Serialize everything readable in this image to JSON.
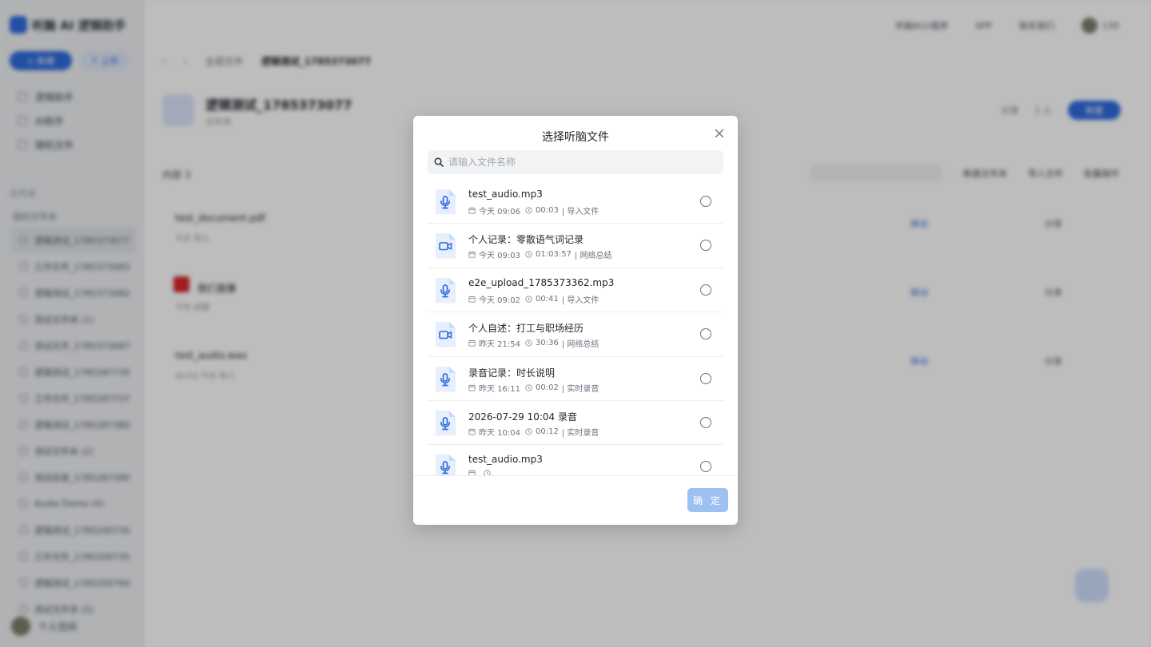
{
  "app": {
    "logo_text": "听脑 AI 逻辑助手",
    "new_button": "+ 新建",
    "upload_button": "↑ 上传",
    "nav": [
      "逻辑助手",
      "AI助手",
      "随机文件"
    ],
    "section_label": "文件夹",
    "subsection_label": "我的文件夹",
    "folders": [
      "逻辑测试_1785373077",
      "工作文件_1785373083",
      "逻辑测试_1785373082",
      "测试文件夹 (1)",
      "测试文件_1785373087",
      "逻辑测试_1785287730",
      "工作文件_1785287737",
      "逻辑测试_1785287380",
      "测试文件夹 (2)",
      "测试目录_1785287390",
      "Audio Demo (4)",
      "逻辑测试_1785200730",
      "工作文件_1785200735",
      "逻辑测试_1785200760",
      "测试文件夹 (5)"
    ],
    "user_name": "个人空间",
    "topbar": [
      "听脑AI小程序",
      "APP",
      "联系我们",
      "130"
    ],
    "breadcrumb": [
      "全部文件",
      "逻辑测试_1785373077"
    ],
    "folder_title": "逻辑测试_1785373077",
    "folder_sub": "文件夹",
    "share_label": "分享",
    "member_label": "1 人",
    "action_button": "新建",
    "list_header": "内容 3",
    "toolbar": [
      "新建文件夹",
      "导入文件",
      "批量操作"
    ],
    "rows": [
      {
        "name": "test_document.pdf",
        "meta": "今天 导入",
        "r1": "移动",
        "r2": "分享"
      },
      {
        "name": "我们直播",
        "meta": "今天 创建",
        "r1": "移动",
        "r2": "分享"
      },
      {
        "name": "test_audio.wav",
        "meta": "00:03  今天 导入",
        "r1": "移动",
        "r2": "分享"
      }
    ]
  },
  "modal": {
    "title": "选择听脑文件",
    "search_placeholder": "请输入文件名称",
    "confirm_label": "确 定",
    "files": [
      {
        "name": "test_audio.mp3",
        "date": "今天 09:06",
        "duration": "00:03",
        "source": "| 导入文件",
        "icon": "audio-file-icon"
      },
      {
        "name": "个人记录：零散语气词记录",
        "date": "今天 09:03",
        "duration": "01:03:57",
        "source": "| 网络总结",
        "icon": "video-file-icon"
      },
      {
        "name": "e2e_upload_1785373362.mp3",
        "date": "今天 09:02",
        "duration": "00:41",
        "source": "| 导入文件",
        "icon": "audio-file-icon"
      },
      {
        "name": "个人自述：打工与职场经历",
        "date": "昨天 21:54",
        "duration": "30:36",
        "source": "| 网络总结",
        "icon": "video-file-icon"
      },
      {
        "name": "录音记录：时长说明",
        "date": "昨天 16:11",
        "duration": "00:02",
        "source": "| 实时录音",
        "icon": "audio-file-icon"
      },
      {
        "name": "2026-07-29 10:04 录音",
        "date": "昨天 10:04",
        "duration": "00:12",
        "source": "| 实时录音",
        "icon": "audio-file-icon"
      },
      {
        "name": "test_audio.mp3",
        "date": "",
        "duration": "",
        "source": "",
        "icon": "audio-file-icon"
      }
    ]
  }
}
